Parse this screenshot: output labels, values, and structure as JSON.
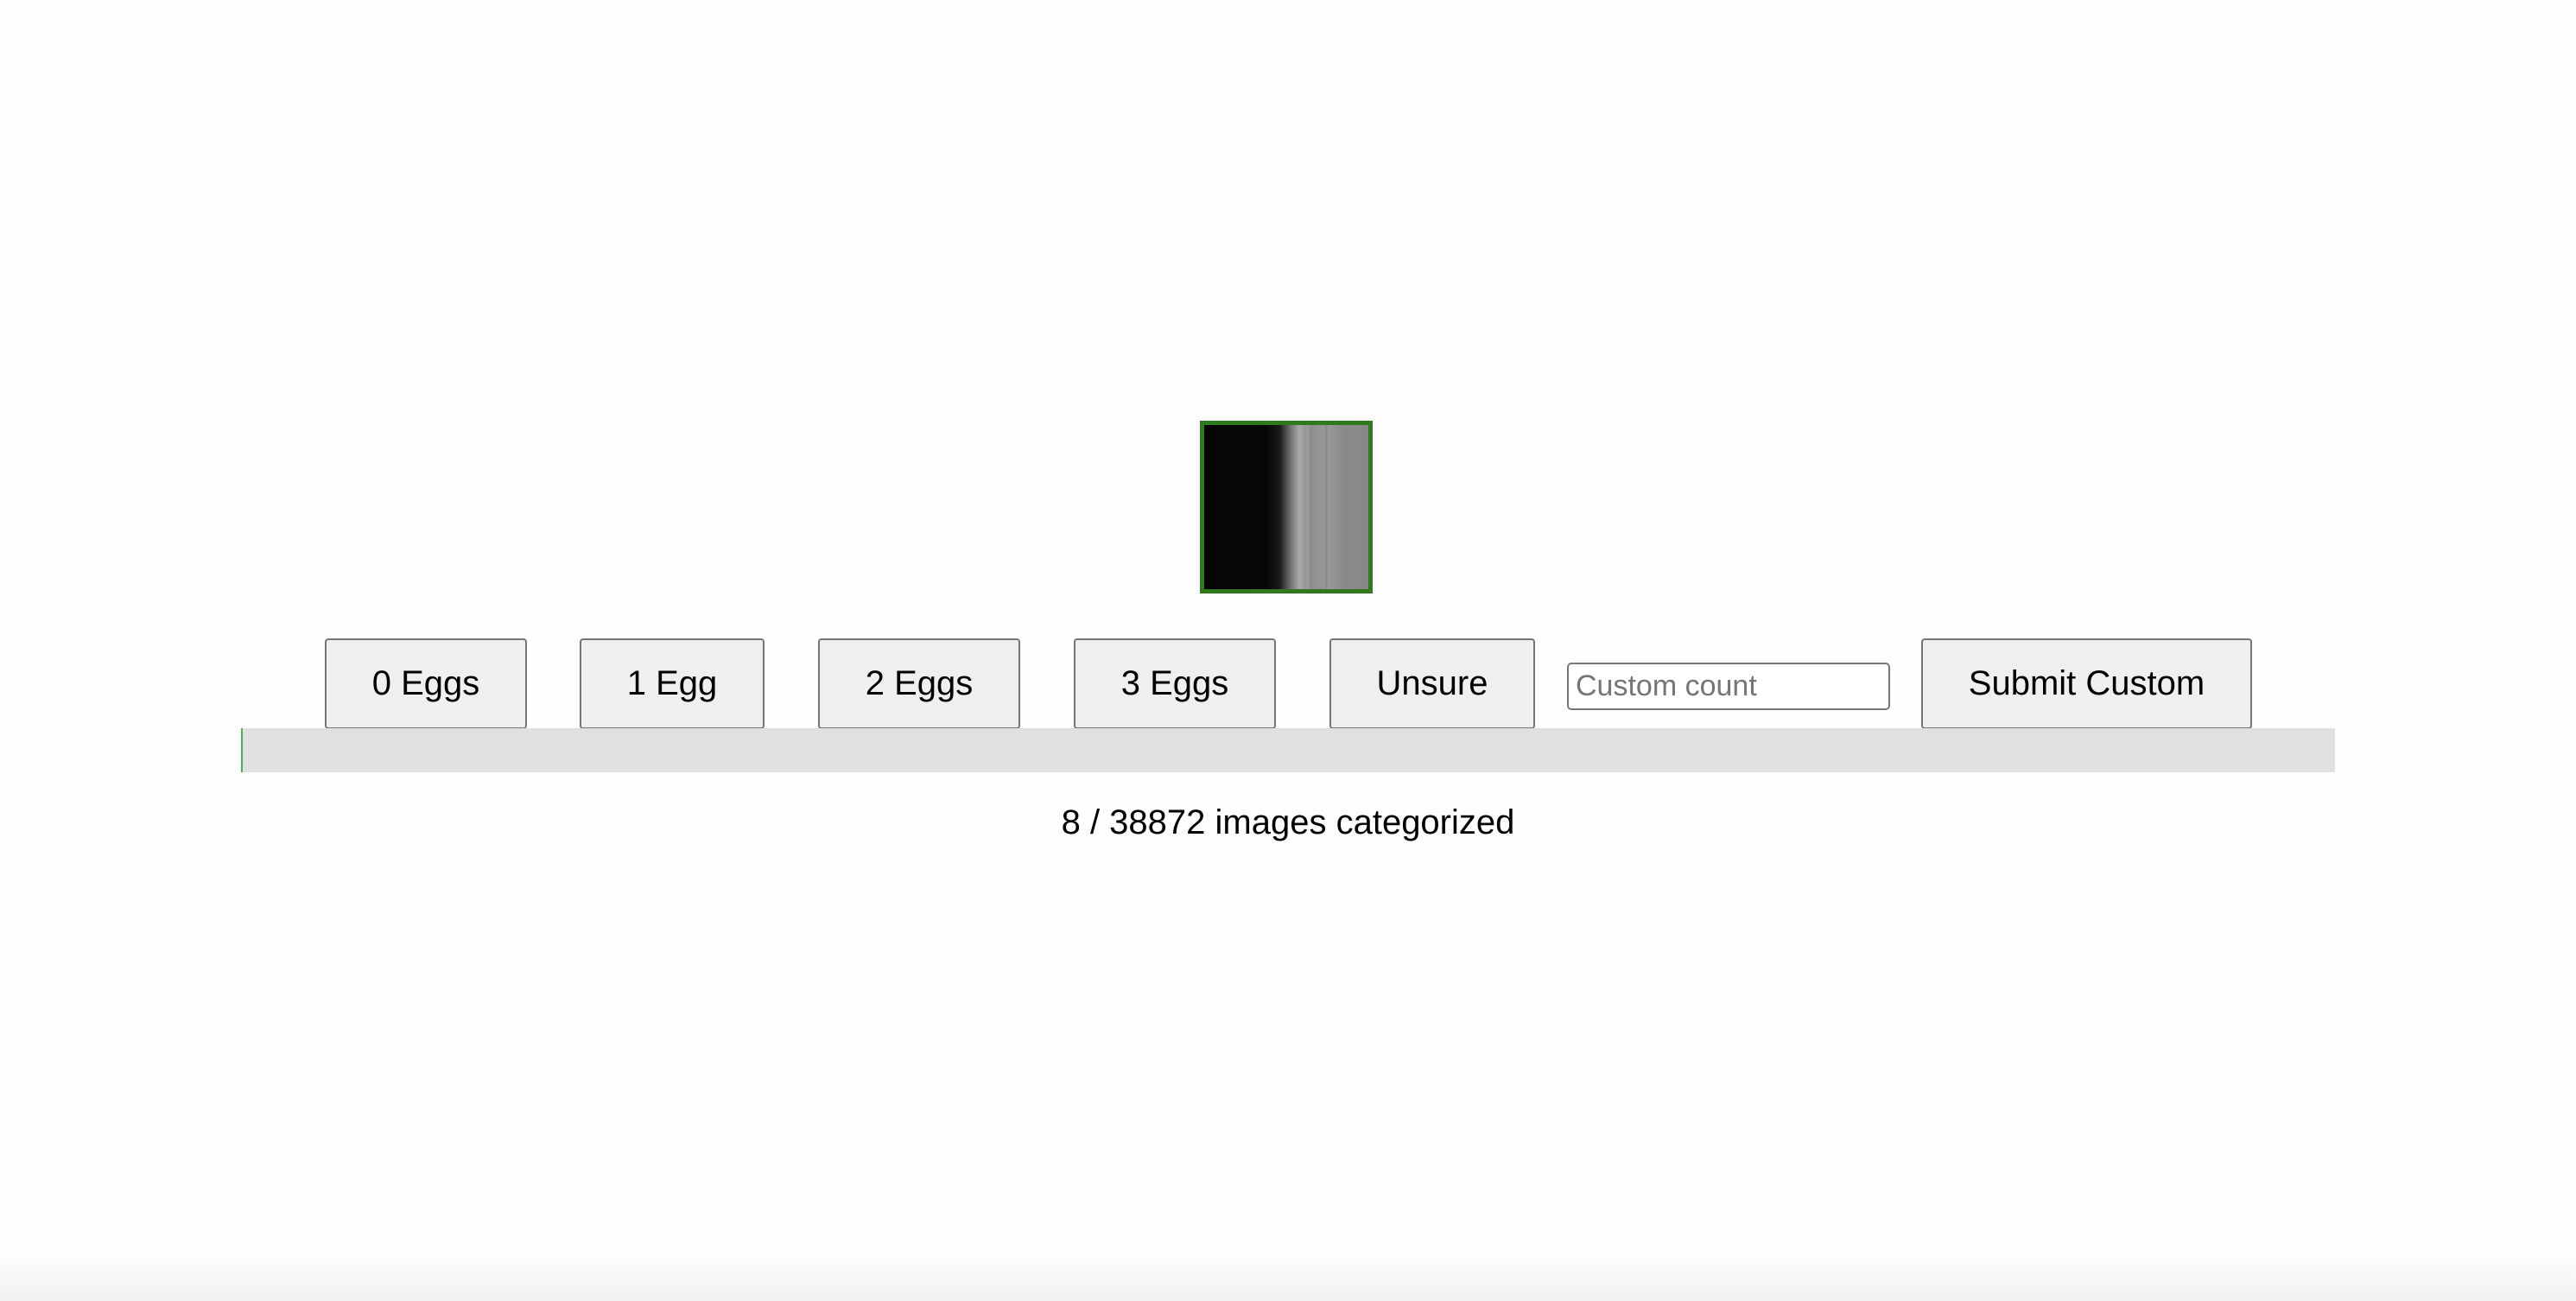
{
  "image": {
    "icon": "specimen-image",
    "border_color": "#2f7a1f"
  },
  "buttons": {
    "zero": "0 Eggs",
    "one": "1 Egg",
    "two": "2 Eggs",
    "three": "3 Eggs",
    "unsure": "Unsure",
    "submit_custom": "Submit Custom"
  },
  "custom_input": {
    "placeholder": "Custom count",
    "value": ""
  },
  "progress": {
    "categorized": 8,
    "total": 38872,
    "fraction": 0.000206,
    "fill_color": "#4caf50",
    "track_color": "#e0e0e0",
    "label": "8 / 38872 images categorized"
  }
}
